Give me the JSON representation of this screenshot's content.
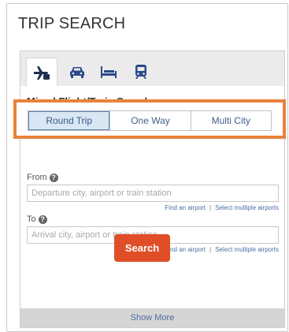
{
  "title": "TRIP SEARCH",
  "tabs": [
    {
      "name": "flight-train-icon",
      "active": true
    },
    {
      "name": "car-icon",
      "active": false
    },
    {
      "name": "hotel-bed-icon",
      "active": false
    },
    {
      "name": "train-icon",
      "active": false
    }
  ],
  "mode_title": "Mixed Flight/Train Search",
  "trip_types": [
    "Round Trip",
    "One Way",
    "Multi City"
  ],
  "selected_trip_type": "Round Trip",
  "from": {
    "label": "From",
    "placeholder": "Departure city, airport or train station",
    "find_link": "Find an airport",
    "multi_link": "Select multiple airports"
  },
  "to": {
    "label": "To",
    "placeholder": "Arrival city, airport or train station",
    "find_link": "Find an airport",
    "multi_link": "Select multiple airports"
  },
  "search_label": "Search",
  "show_more_label": "Show More",
  "colors": {
    "highlight": "#e8833a",
    "search_button": "#e04e28",
    "link": "#4b6ea3",
    "selected_segment": "#d9e6f4"
  }
}
